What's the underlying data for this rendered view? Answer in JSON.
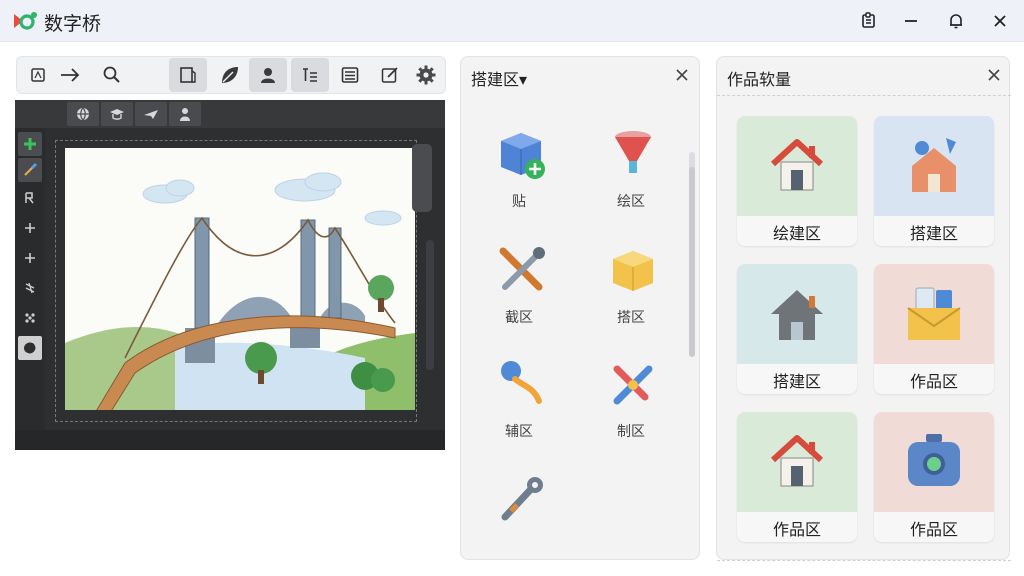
{
  "app": {
    "title": "数字桥"
  },
  "colors": {
    "title_bar_bg": "#eef1f7",
    "editor_bg": "#2e2f31",
    "card_green": "#d9ead9",
    "card_blue": "#d8e4f2",
    "card_teal": "#d6e8ea",
    "card_pink": "#f1dbd6"
  },
  "window_controls": [
    "puzzle-icon",
    "minimize-icon",
    "bell-icon",
    "close-icon"
  ],
  "toolbar": {
    "icons": [
      "layout-icon",
      "arrow-right-icon",
      "search-icon",
      "book-icon",
      "leaf-icon",
      "person-icon",
      "text-tool-icon",
      "list-icon",
      "edit-icon",
      "gear-icon"
    ],
    "active_indices": [
      3,
      5,
      6
    ]
  },
  "editor": {
    "top_tools": [
      "globe-icon",
      "cap-icon",
      "plane-icon",
      "figure-icon"
    ],
    "left_tools": [
      "plus-green-icon",
      "brush-icon",
      "text-icon",
      "add-icon",
      "add-icon",
      "stroke-icon",
      "dots-icon",
      "shape-icon"
    ],
    "canvas_image": "bridge illustration"
  },
  "build_panel": {
    "title": "搭建区▾",
    "tools": [
      {
        "label": "贴",
        "icon": "blue-cube-plus-icon"
      },
      {
        "label": "绘区",
        "icon": "funnel-icon"
      },
      {
        "label": "截区",
        "icon": "wrench-screwdriver-icon"
      },
      {
        "label": "搭区",
        "icon": "yellow-cube-icon"
      },
      {
        "label": "辅区",
        "icon": "pin-tool-icon"
      },
      {
        "label": "制区",
        "icon": "wrench-hammer-icon"
      },
      {
        "label": "",
        "icon": "wrench-icon"
      }
    ]
  },
  "works_panel": {
    "title": "作品软量",
    "cards": [
      {
        "label": "绘建区",
        "icon": "house-icon",
        "color": "#d9ead9"
      },
      {
        "label": "搭建区",
        "icon": "house-ideas-icon",
        "color": "#d8e4f2"
      },
      {
        "label": "搭建区",
        "icon": "gray-house-icon",
        "color": "#d6e8ea"
      },
      {
        "label": "作品区",
        "icon": "envelope-icon",
        "color": "#f1dbd6"
      },
      {
        "label": "作品区",
        "icon": "house-icon",
        "color": "#d9ead9"
      },
      {
        "label": "作品区",
        "icon": "camera-icon",
        "color": "#f1dbd6"
      }
    ]
  }
}
